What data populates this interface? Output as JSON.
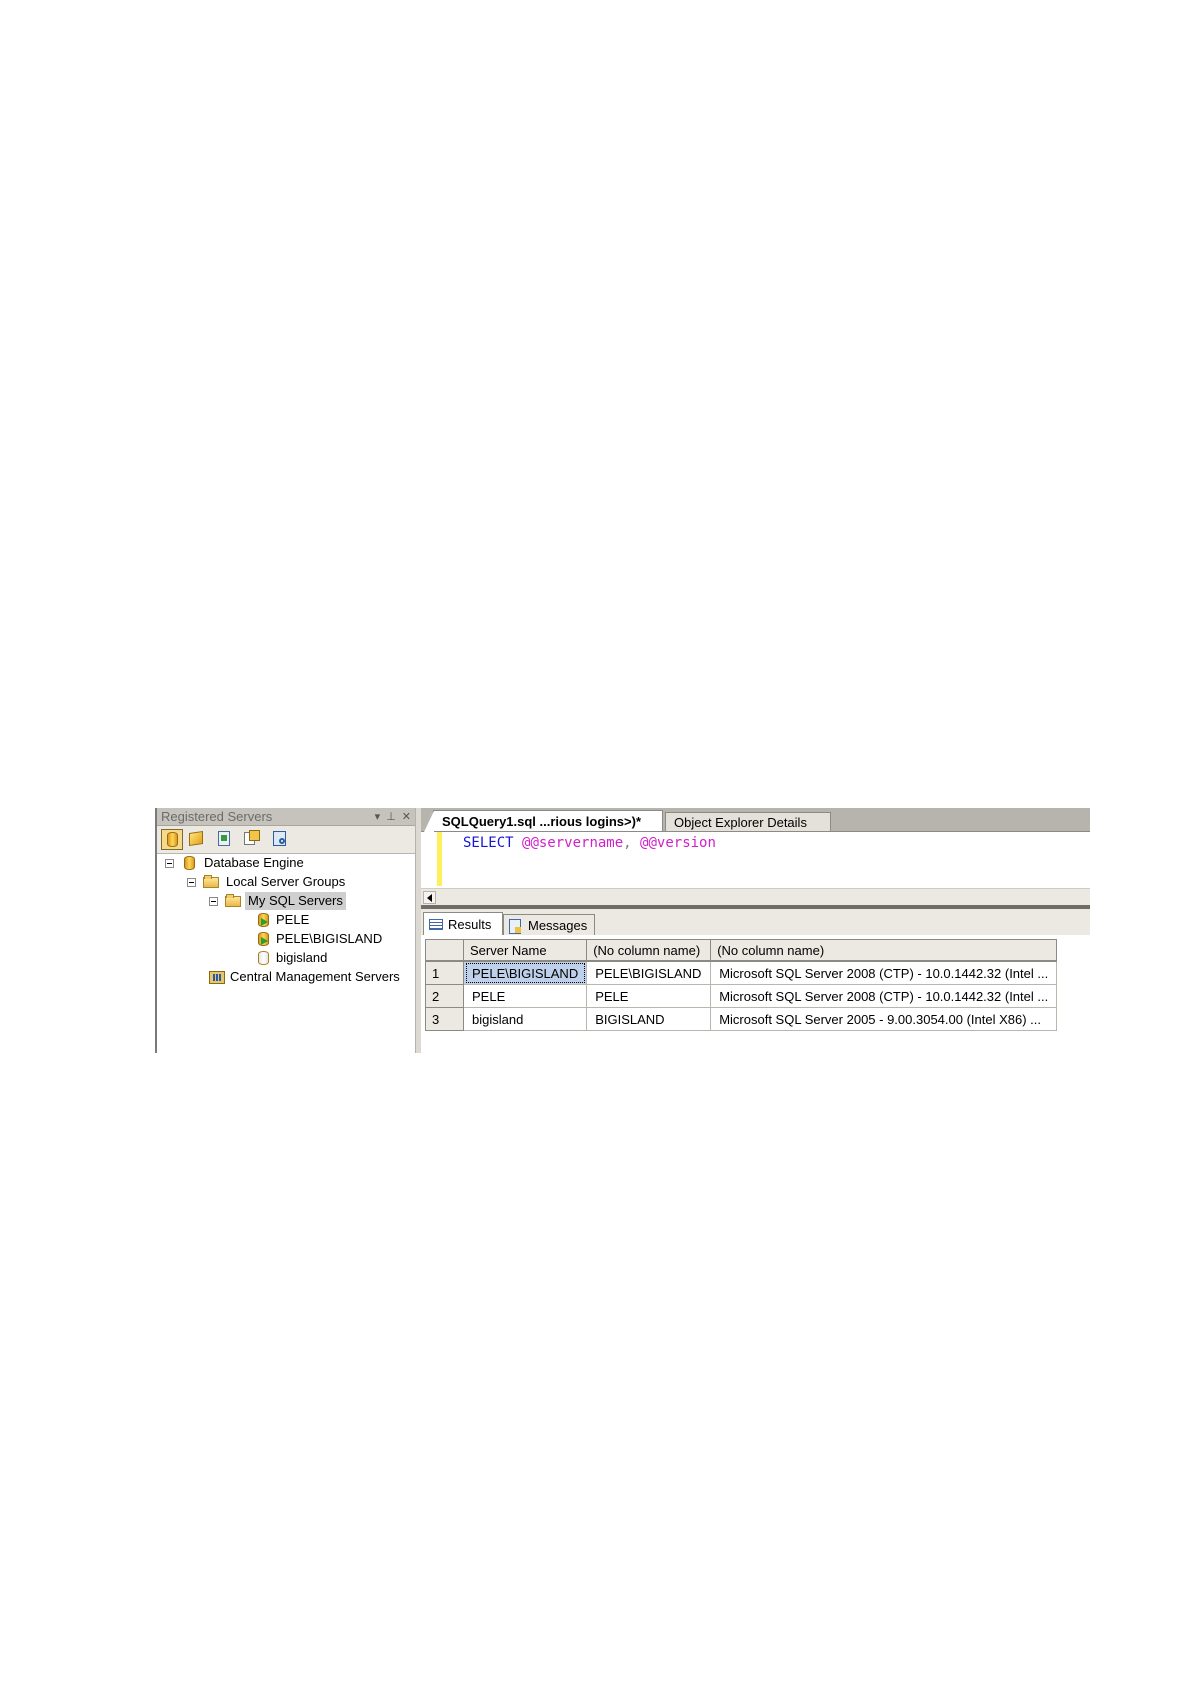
{
  "registered_servers": {
    "title": "Registered Servers",
    "title_controls": [
      "▾",
      "⊥",
      "✕"
    ],
    "toolbar": [
      "database-engine-icon",
      "analysis-services-icon",
      "reporting-services-icon",
      "integration-services-icon",
      "sql-compact-icon"
    ],
    "tree": {
      "database_engine": "Database Engine",
      "local_server_groups": "Local Server Groups",
      "my_sql_servers": "My SQL Servers",
      "servers": [
        "PELE",
        "PELE\\BIGISLAND",
        "bigisland"
      ],
      "central_management": "Central Management Servers"
    }
  },
  "tabs": {
    "query": "SQLQuery1.sql ...rious logins>)*",
    "object_explorer_details": "Object Explorer Details"
  },
  "editor": {
    "keyword": "SELECT",
    "fn1": "@@servername",
    "comma": ",",
    "fn2": "@@version"
  },
  "results_tabs": {
    "results": "Results",
    "messages": "Messages"
  },
  "grid": {
    "headers": [
      "Server Name",
      "(No column name)",
      "(No column name)"
    ],
    "rows": [
      {
        "n": "1",
        "server": "PELE\\BIGISLAND",
        "name": "PELE\\BIGISLAND",
        "version": "Microsoft SQL Server 2008 (CTP) - 10.0.1442.32 (Intel ..."
      },
      {
        "n": "2",
        "server": "PELE",
        "name": "PELE",
        "version": "Microsoft SQL Server 2008 (CTP) - 10.0.1442.32 (Intel ..."
      },
      {
        "n": "3",
        "server": "bigisland",
        "name": "BIGISLAND",
        "version": "Microsoft SQL Server 2005 - 9.00.3054.00 (Intel X86)   ..."
      }
    ]
  },
  "colors": {
    "keyword": "#1515d8",
    "function": "#d11fc9",
    "selected_cell": "#bfd0ea",
    "chrome": "#ece9e3"
  }
}
